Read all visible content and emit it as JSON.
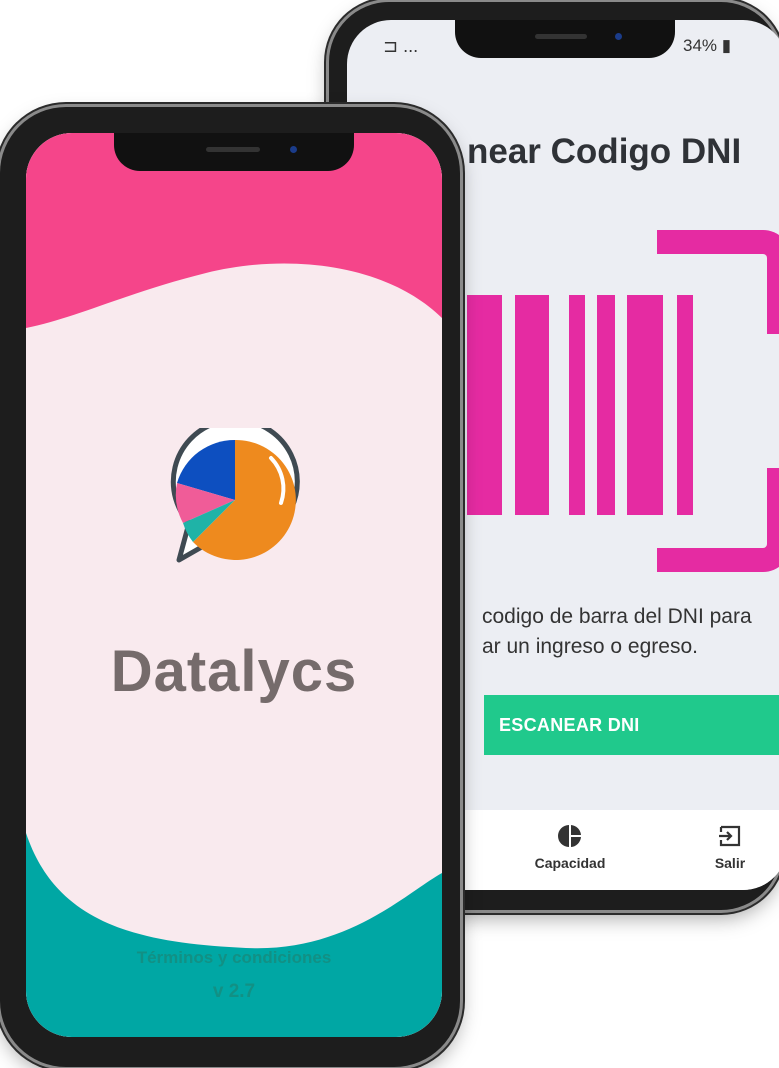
{
  "back_screen": {
    "status_left": "⊐ ...",
    "status_right": "34%",
    "title": "near Codigo DNI",
    "description_line1": "codigo de barra del DNI para",
    "description_line2": "ar un ingreso o egreso.",
    "scan_button": "ESCANEAR DNI",
    "nav": {
      "capacity_label": "Capacidad",
      "exit_label": "Salir"
    }
  },
  "front_screen": {
    "brand": "Datalycs",
    "terms_link": "Términos y condiciones",
    "version": "v 2.7"
  },
  "colors": {
    "pink": "#f5458a",
    "magenta_barcode": "#e52ba2",
    "teal": "#00a7a4",
    "green_button": "#20c98c",
    "logo_orange": "#ee8a1e",
    "logo_blue": "#0d4fc0",
    "logo_pink": "#f05c98",
    "logo_teal": "#1fb3a7"
  },
  "icons": [
    "pie-chart-icon",
    "exit-icon",
    "logo-pie-bubble-icon",
    "barcode-icon",
    "monitor-icon"
  ]
}
